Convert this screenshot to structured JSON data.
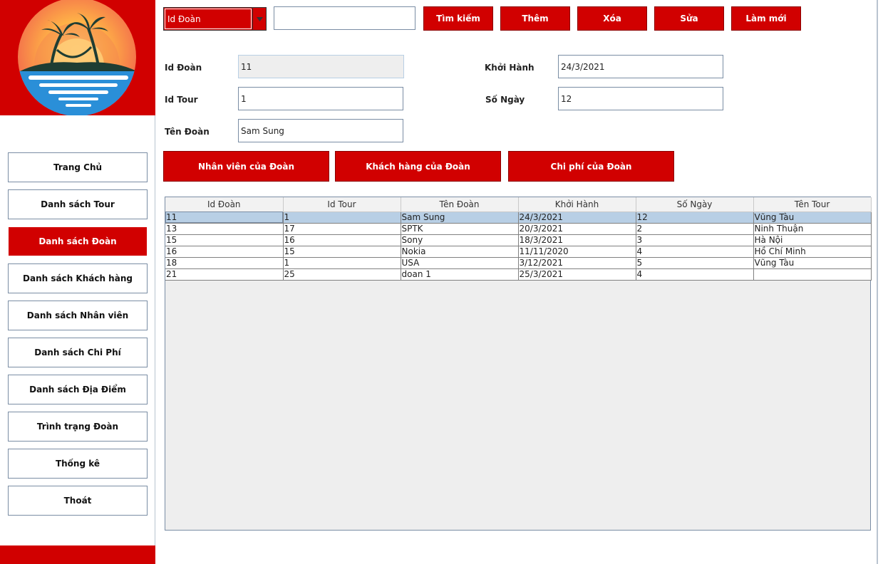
{
  "sidebar": {
    "items": [
      {
        "label": "Trang Chủ",
        "active": false
      },
      {
        "label": "Danh sách Tour",
        "active": false
      },
      {
        "label": "Danh sách Đoàn",
        "active": true
      },
      {
        "label": "Danh sách Khách hàng",
        "active": false
      },
      {
        "label": "Danh sách Nhân viên",
        "active": false
      },
      {
        "label": "Danh sách Chi Phí",
        "active": false
      },
      {
        "label": "Danh sách Địa Điểm",
        "active": false
      },
      {
        "label": "Trình trạng Đoàn",
        "active": false
      },
      {
        "label": "Thống kê",
        "active": false
      },
      {
        "label": "Thoát",
        "active": false
      }
    ]
  },
  "toolbar": {
    "search_field_selected": "Id Đoàn",
    "search_value": "",
    "search_label": "Tìm kiếm",
    "add_label": "Thêm",
    "delete_label": "Xóa",
    "edit_label": "Sửa",
    "refresh_label": "Làm mới"
  },
  "form": {
    "id_doan": {
      "label": "Id Đoàn",
      "value": "11"
    },
    "id_tour": {
      "label": "Id Tour",
      "value": "1"
    },
    "ten_doan": {
      "label": "Tên Đoàn",
      "value": "Sam Sung"
    },
    "khoi_hanh": {
      "label": "Khởi Hành",
      "value": "24/3/2021"
    },
    "so_ngay": {
      "label": "Số Ngày",
      "value": "12"
    }
  },
  "actions": {
    "staff_label": "Nhân viên của Đoàn",
    "customers_label": "Khách hàng của Đoàn",
    "costs_label": "Chi phí của Đoàn"
  },
  "table": {
    "columns": [
      "Id Đoàn",
      "Id Tour",
      "Tên Đoàn",
      "Khởi Hành",
      "Số Ngày",
      "Tên Tour"
    ],
    "selected_row": 0,
    "rows": [
      [
        "11",
        "1",
        "Sam Sung",
        "24/3/2021",
        "12",
        "Vũng Tàu"
      ],
      [
        "13",
        "17",
        "SPTK",
        "20/3/2021",
        "2",
        "Ninh Thuận"
      ],
      [
        "15",
        "16",
        "Sony",
        "18/3/2021",
        "3",
        "Hà Nội"
      ],
      [
        "16",
        "15",
        "Nokia",
        "11/11/2020",
        "4",
        "Hồ Chí Minh"
      ],
      [
        "18",
        "1",
        "USA",
        "3/12/2021",
        "5",
        "Vũng Tàu"
      ],
      [
        "21",
        "25",
        "doan 1",
        "25/3/2021",
        "4",
        ""
      ]
    ]
  },
  "colors": {
    "accent": "#d10000",
    "selection": "#b8cfe5",
    "border": "#7a8da4"
  },
  "icons": {
    "logo": "sunset-palm-logo",
    "combo_arrow": "dropdown-arrow-icon"
  }
}
